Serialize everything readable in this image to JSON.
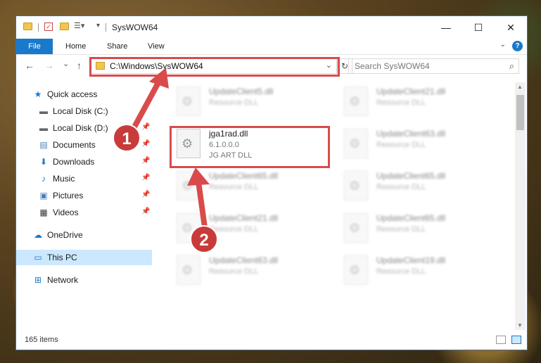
{
  "window": {
    "title": "SysWOW64",
    "controls": {
      "minimize": "—",
      "maximize": "☐",
      "close": "✕"
    }
  },
  "ribbon": {
    "file_tab": "File",
    "tabs": [
      "Home",
      "Share",
      "View"
    ],
    "help": "?"
  },
  "nav": {
    "back": "←",
    "forward": "→",
    "recent": "⌄",
    "up": "↑",
    "address": "C:\\Windows\\SysWOW64",
    "address_dropdown": "⌄",
    "refresh": "↻",
    "search_placeholder": "Search SysWOW64"
  },
  "sidebar": {
    "items": [
      {
        "label": "Quick access",
        "icon": "star-icon",
        "pinned": false
      },
      {
        "label": "Local Disk (C:)",
        "icon": "drive-icon",
        "pinned": false
      },
      {
        "label": "Local Disk (D:)",
        "icon": "drive-icon",
        "pinned": true
      },
      {
        "label": "Documents",
        "icon": "documents-icon",
        "pinned": true
      },
      {
        "label": "Downloads",
        "icon": "download-icon",
        "pinned": true
      },
      {
        "label": "Music",
        "icon": "music-icon",
        "pinned": true
      },
      {
        "label": "Pictures",
        "icon": "pictures-icon",
        "pinned": true
      },
      {
        "label": "Videos",
        "icon": "videos-icon",
        "pinned": true
      },
      {
        "label": "OneDrive",
        "icon": "cloud-icon",
        "pinned": false
      },
      {
        "label": "This PC",
        "icon": "computer-icon",
        "pinned": false,
        "selected": true
      },
      {
        "label": "Network",
        "icon": "network-icon",
        "pinned": false
      }
    ]
  },
  "files": {
    "highlighted": {
      "name": "jga1rad.dll",
      "version": "6.1.0.0.0",
      "description": "JG ART DLL"
    },
    "left_column": [
      {
        "name": "UpdateClient5.dll",
        "type": "Resource DLL"
      },
      {
        "name": "UpdateClient65.dll",
        "type": "Resource DLL"
      },
      {
        "name": "UpdateClient21.dll",
        "type": "Resource DLL"
      },
      {
        "name": "UpdateClient63.dll",
        "type": "Resource DLL"
      }
    ],
    "right_column": [
      {
        "name": "UpdateClient21.dll",
        "type": "Resource DLL"
      },
      {
        "name": "UpdateClient63.dll",
        "type": "Resource DLL"
      },
      {
        "name": "UpdateClient65.dll",
        "type": "Resource DLL"
      },
      {
        "name": "UpdateClient65.dll",
        "type": "Resource DLL"
      },
      {
        "name": "UpdateClient19.dll",
        "type": "Resource DLL"
      }
    ]
  },
  "status": {
    "items": "165 items"
  },
  "annotations": {
    "step1": "1",
    "step2": "2",
    "highlight_color": "#d94b4b"
  }
}
